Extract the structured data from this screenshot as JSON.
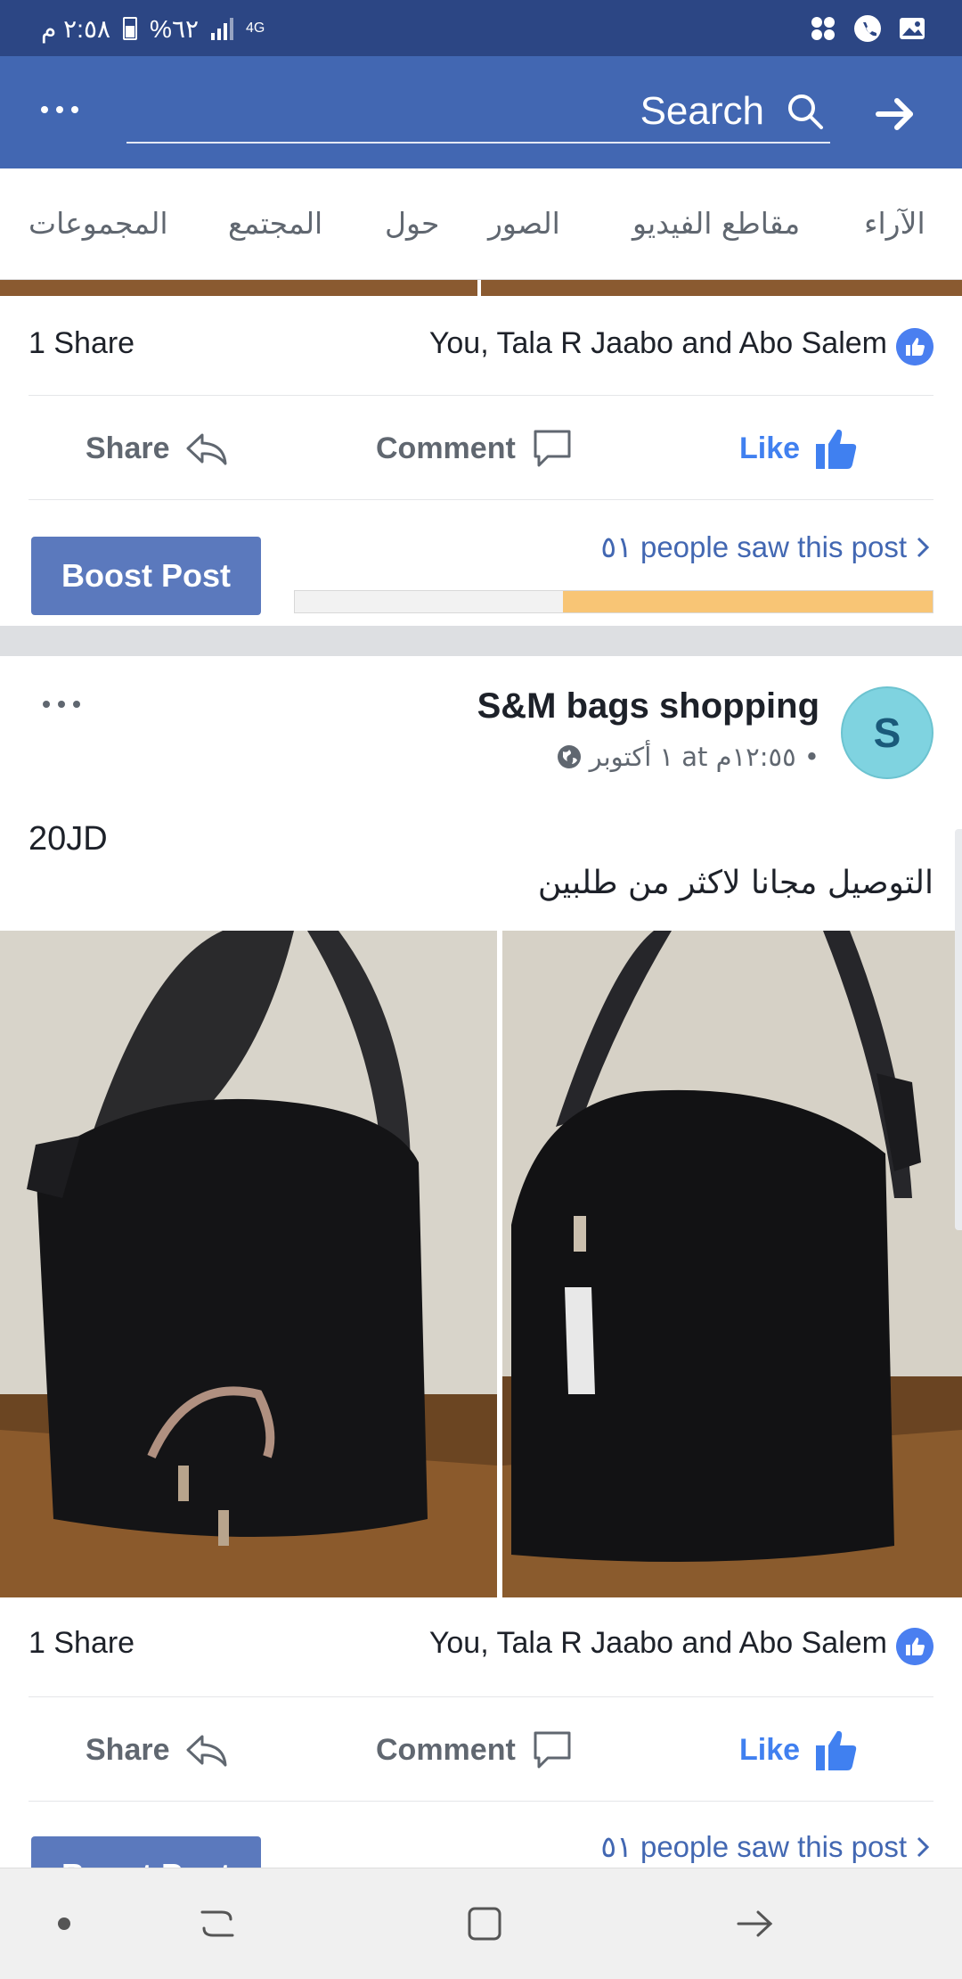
{
  "status_bar": {
    "time": "٢:٥٨ م",
    "battery": "%٦٢",
    "network": "4G"
  },
  "header": {
    "search_placeholder": "Search",
    "more_icon": "more-icon",
    "forward_icon": "arrow-right-icon"
  },
  "tabs": [
    {
      "label": "الآراء"
    },
    {
      "label": "مقاطع الفيديو"
    },
    {
      "label": "الصور"
    },
    {
      "label": "حول"
    },
    {
      "label": "المجتمع"
    },
    {
      "label": "المجموعات"
    }
  ],
  "posts": [
    {
      "shares": "1 Share",
      "likes": "You, Tala R Jaabo and Abo Salem",
      "actions": {
        "share": "Share",
        "comment": "Comment",
        "like": "Like"
      },
      "boost_label": "Boost Post",
      "reach_text": "٥١ people saw this post",
      "reach_fraction": 0.42
    },
    {
      "page_name": "S&M bags shopping",
      "avatar_letter": "S",
      "meta": "١ أكتوبر at ١٢:٥٥م •",
      "price": "20JD",
      "description": "التوصيل مجانا لاكثر من طلبين",
      "shares": "1 Share",
      "likes": "You, Tala R Jaabo and Abo Salem",
      "actions": {
        "share": "Share",
        "comment": "Comment",
        "like": "Like"
      },
      "boost_label": "Boost Post",
      "reach_text": "٥١ people saw this post"
    }
  ],
  "colors": {
    "status_bar": "#2c4684",
    "header": "#4267b2",
    "like_blue": "#4080f0",
    "boost_button": "#5b79bd",
    "reach_fill": "#f8c575"
  }
}
